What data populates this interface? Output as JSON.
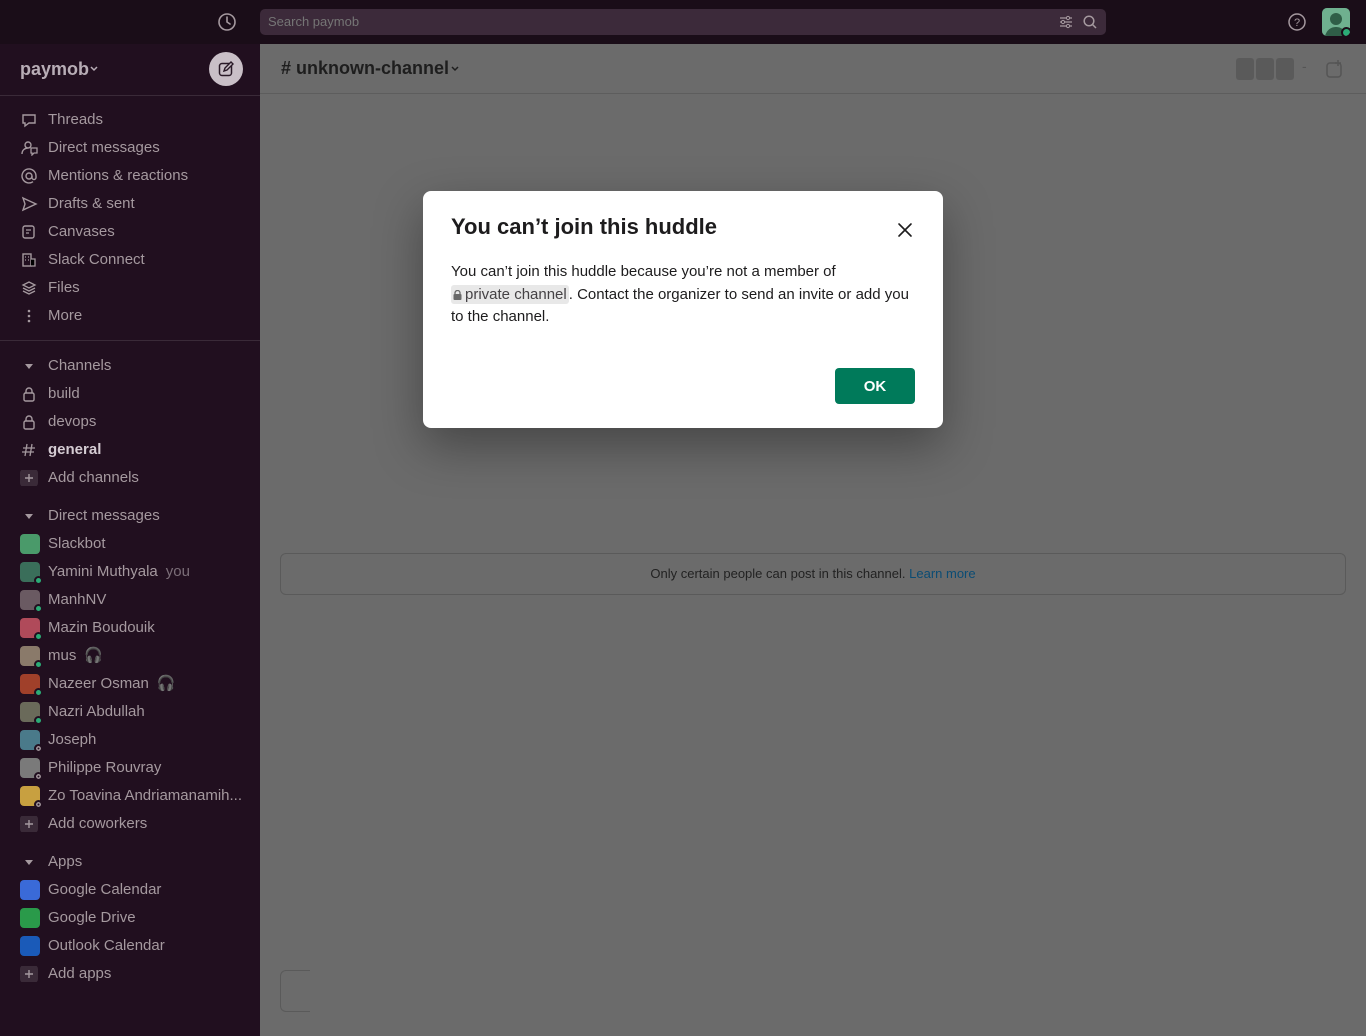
{
  "topbar": {
    "search_placeholder": "Search paymob"
  },
  "sidebar": {
    "workspace_name": "paymob",
    "nav": [
      {
        "label": "Threads",
        "icon": "threads-icon"
      },
      {
        "label": "Direct messages",
        "icon": "direct-messages-icon"
      },
      {
        "label": "Mentions & reactions",
        "icon": "at-icon"
      },
      {
        "label": "Drafts & sent",
        "icon": "send-icon"
      },
      {
        "label": "Canvases",
        "icon": "canvas-icon"
      },
      {
        "label": "Slack Connect",
        "icon": "building-icon"
      },
      {
        "label": "Files",
        "icon": "files-icon"
      },
      {
        "label": "More",
        "icon": "more-icon"
      }
    ],
    "channels_header": "Channels",
    "channels": [
      {
        "label": "build",
        "icon": "lock-icon"
      },
      {
        "label": "devops",
        "icon": "lock-icon"
      },
      {
        "label": "general",
        "icon": "hash-icon"
      }
    ],
    "add_channels": "Add channels",
    "dm_header": "Direct messages",
    "dms": [
      {
        "label": "Slackbot",
        "suffix": "",
        "color": "#4a9a6a",
        "status": ""
      },
      {
        "label": "Yamini Muthyala",
        "suffix": "you",
        "color": "#3a6e5a",
        "status": "on"
      },
      {
        "label": "ManhNV",
        "suffix": "",
        "color": "#6a5a62",
        "status": "on"
      },
      {
        "label": "Mazin Boudouik",
        "suffix": "",
        "color": "#b04a5a",
        "status": "on"
      },
      {
        "label": "mus",
        "suffix": "🎧",
        "color": "#8a7a6a",
        "status": "on"
      },
      {
        "label": "Nazeer Osman",
        "suffix": "🎧",
        "color": "#a0402a",
        "status": "on"
      },
      {
        "label": "Nazri Abdullah",
        "suffix": "",
        "color": "#6a6a5a",
        "status": "on"
      },
      {
        "label": "Joseph",
        "suffix": "",
        "color": "#4a7a8a",
        "status": "off"
      },
      {
        "label": "Philippe Rouvray",
        "suffix": "",
        "color": "#7a7a7a",
        "status": "off"
      },
      {
        "label": "Zo Toavina Andriamanamih...",
        "suffix": "",
        "color": "#c8a040",
        "status": "off"
      }
    ],
    "add_coworkers": "Add coworkers",
    "apps_header": "Apps",
    "apps": [
      {
        "label": "Google Calendar",
        "color": "#3a6ad8"
      },
      {
        "label": "Google Drive",
        "color": "#2a9a4a"
      },
      {
        "label": "Outlook Calendar",
        "color": "#1a5ab8"
      }
    ],
    "add_apps": "Add apps"
  },
  "main": {
    "channel_name": "# unknown-channel",
    "notice_text": "Only certain people can post in this channel.",
    "notice_link": "Learn more"
  },
  "modal": {
    "title": "You can’t join this huddle",
    "body_before": "You can’t join this huddle because you’re not a member of",
    "pill": "private channel",
    "body_after": ". Contact the organizer to send an invite or add you to the channel.",
    "ok_label": "OK"
  },
  "colors": {
    "sidebar_bg": "#210f1f",
    "topbar_bg": "#1a0d18",
    "ok_button": "#007a5a",
    "link": "#1264a3"
  }
}
